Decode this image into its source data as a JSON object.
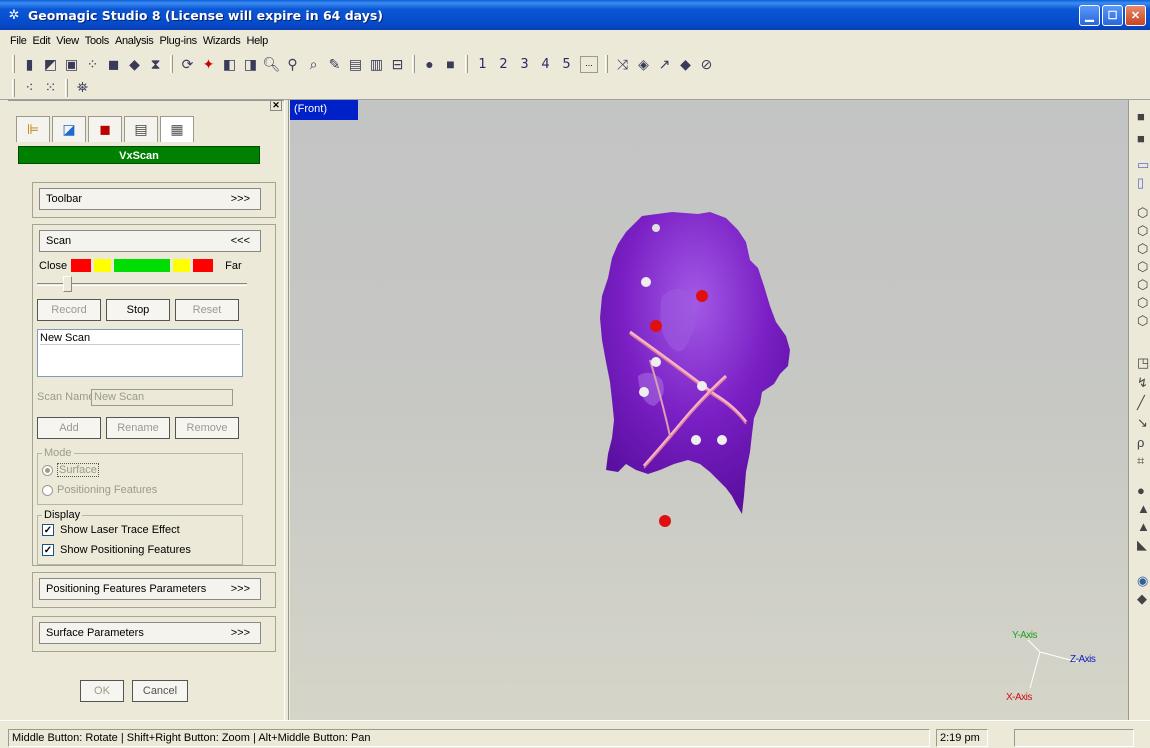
{
  "window": {
    "title": "Geomagic Studio 8 (License will expire in 64 days)"
  },
  "menu": [
    "File",
    "Edit",
    "View",
    "Tools",
    "Analysis",
    "Plug-ins",
    "Wizards",
    "Help"
  ],
  "toolbar": {
    "numbers": [
      "1",
      "2",
      "3",
      "4",
      "5"
    ],
    "more": "..."
  },
  "panel": {
    "header": "VxScan",
    "toolbar_section": {
      "label": "Toolbar",
      "toggle": ">>>"
    },
    "scan_section": {
      "label": "Scan",
      "toggle": "<<<",
      "close_label": "Close",
      "far_label": "Far",
      "record": "Record",
      "stop": "Stop",
      "reset": "Reset",
      "list_items": [
        "New Scan"
      ],
      "scan_name_label": "Scan Name",
      "scan_name_value": "New Scan",
      "add": "Add",
      "rename": "Rename",
      "remove": "Remove",
      "mode_label": "Mode",
      "mode_surface": "Surface",
      "mode_positioning": "Positioning Features",
      "display_label": "Display",
      "show_laser": "Show Laser Trace Effect",
      "show_positioning": "Show Positioning Features"
    },
    "positioning_params": {
      "label": "Positioning Features Parameters",
      "toggle": ">>>"
    },
    "surface_params": {
      "label": "Surface Parameters",
      "toggle": ">>>"
    },
    "ok": "OK",
    "cancel": "Cancel"
  },
  "viewport": {
    "view_label": "(Front)",
    "axes": {
      "y": "Y-Axis",
      "z": "Z-Axis",
      "x": "X-Axis"
    }
  },
  "status": {
    "hint": "Middle Button: Rotate | Shift+Right Button: Zoom | Alt+Middle Button: Pan",
    "time": "2:19 pm"
  },
  "colors": {
    "mesh": "#7a1fc4",
    "marker_red": "#e01010",
    "header_green": "#008000",
    "legend": [
      "#ff0000",
      "#ffff00",
      "#00dd00",
      "#ffff00",
      "#ff0000"
    ]
  }
}
